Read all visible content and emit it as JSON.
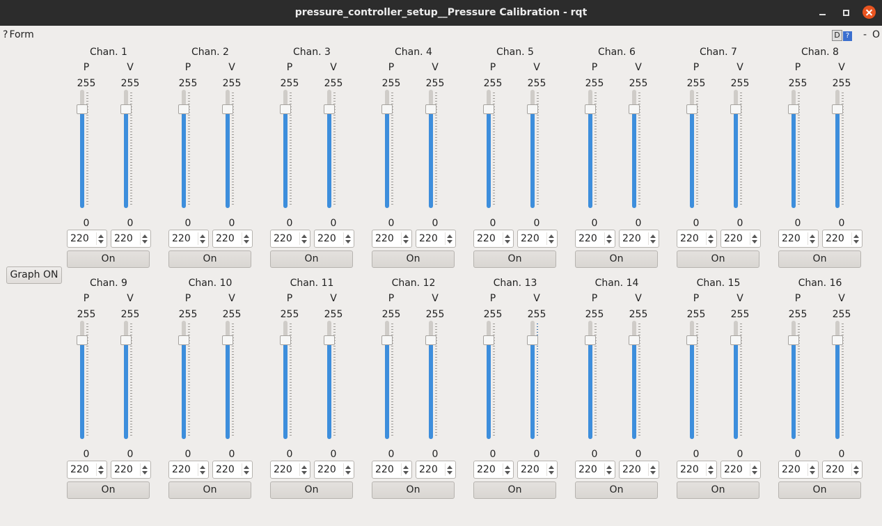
{
  "window": {
    "title": "pressure_controller_setup__Pressure Calibration - rqt"
  },
  "plugin": {
    "help_glyph": "?",
    "title": "Form",
    "dock_d": "D",
    "dock_help": "?",
    "dock_minimize": "-",
    "dock_close": "O"
  },
  "graph_button": "Graph ON",
  "labels": {
    "p": "P",
    "v": "V"
  },
  "channels": [
    {
      "name": "Chan. 1",
      "p_max": "255",
      "v_max": "255",
      "p_min": "0",
      "v_min": "0",
      "p_level": 0.866,
      "v_level": 0.866,
      "p_spin": "220",
      "v_spin": "220",
      "button": "On"
    },
    {
      "name": "Chan. 2",
      "p_max": "255",
      "v_max": "255",
      "p_min": "0",
      "v_min": "0",
      "p_level": 0.866,
      "v_level": 0.866,
      "p_spin": "220",
      "v_spin": "220",
      "button": "On"
    },
    {
      "name": "Chan. 3",
      "p_max": "255",
      "v_max": "255",
      "p_min": "0",
      "v_min": "0",
      "p_level": 0.866,
      "v_level": 0.866,
      "p_spin": "220",
      "v_spin": "220",
      "button": "On"
    },
    {
      "name": "Chan. 4",
      "p_max": "255",
      "v_max": "255",
      "p_min": "0",
      "v_min": "0",
      "p_level": 0.866,
      "v_level": 0.866,
      "p_spin": "220",
      "v_spin": "220",
      "button": "On"
    },
    {
      "name": "Chan. 5",
      "p_max": "255",
      "v_max": "255",
      "p_min": "0",
      "v_min": "0",
      "p_level": 0.866,
      "v_level": 0.866,
      "p_spin": "220",
      "v_spin": "220",
      "button": "On"
    },
    {
      "name": "Chan. 6",
      "p_max": "255",
      "v_max": "255",
      "p_min": "0",
      "v_min": "0",
      "p_level": 0.866,
      "v_level": 0.866,
      "p_spin": "220",
      "v_spin": "220",
      "button": "On"
    },
    {
      "name": "Chan. 7",
      "p_max": "255",
      "v_max": "255",
      "p_min": "0",
      "v_min": "0",
      "p_level": 0.866,
      "v_level": 0.866,
      "p_spin": "220",
      "v_spin": "220",
      "button": "On"
    },
    {
      "name": "Chan. 8",
      "p_max": "255",
      "v_max": "255",
      "p_min": "0",
      "v_min": "0",
      "p_level": 0.866,
      "v_level": 0.866,
      "p_spin": "220",
      "v_spin": "220",
      "button": "On"
    },
    {
      "name": "Chan. 9",
      "p_max": "255",
      "v_max": "255",
      "p_min": "0",
      "v_min": "0",
      "p_level": 0.866,
      "v_level": 0.866,
      "p_spin": "220",
      "v_spin": "220",
      "button": "On"
    },
    {
      "name": "Chan. 10",
      "p_max": "255",
      "v_max": "255",
      "p_min": "0",
      "v_min": "0",
      "p_level": 0.866,
      "v_level": 0.866,
      "p_spin": "220",
      "v_spin": "220",
      "button": "On"
    },
    {
      "name": "Chan. 11",
      "p_max": "255",
      "v_max": "255",
      "p_min": "0",
      "v_min": "0",
      "p_level": 0.866,
      "v_level": 0.866,
      "p_spin": "220",
      "v_spin": "220",
      "button": "On"
    },
    {
      "name": "Chan. 12",
      "p_max": "255",
      "v_max": "255",
      "p_min": "0",
      "v_min": "0",
      "p_level": 0.866,
      "v_level": 0.866,
      "p_spin": "220",
      "v_spin": "220",
      "button": "On"
    },
    {
      "name": "Chan. 13",
      "p_max": "255",
      "v_max": "255",
      "p_min": "0",
      "v_min": "0",
      "p_level": 0.866,
      "v_level": 0.866,
      "p_spin": "220",
      "v_spin": "220",
      "button": "On"
    },
    {
      "name": "Chan. 14",
      "p_max": "255",
      "v_max": "255",
      "p_min": "0",
      "v_min": "0",
      "p_level": 0.866,
      "v_level": 0.866,
      "p_spin": "220",
      "v_spin": "220",
      "button": "On"
    },
    {
      "name": "Chan. 15",
      "p_max": "255",
      "v_max": "255",
      "p_min": "0",
      "v_min": "0",
      "p_level": 0.866,
      "v_level": 0.866,
      "p_spin": "220",
      "v_spin": "220",
      "button": "On"
    },
    {
      "name": "Chan. 16",
      "p_max": "255",
      "v_max": "255",
      "p_min": "0",
      "v_min": "0",
      "p_level": 0.866,
      "v_level": 0.866,
      "p_spin": "220",
      "v_spin": "220",
      "button": "On"
    }
  ],
  "colors": {
    "titlebar": "#2c2c2c",
    "background": "#efedeb",
    "slider_fill": "#3d8edc",
    "close_button": "#e95420"
  }
}
